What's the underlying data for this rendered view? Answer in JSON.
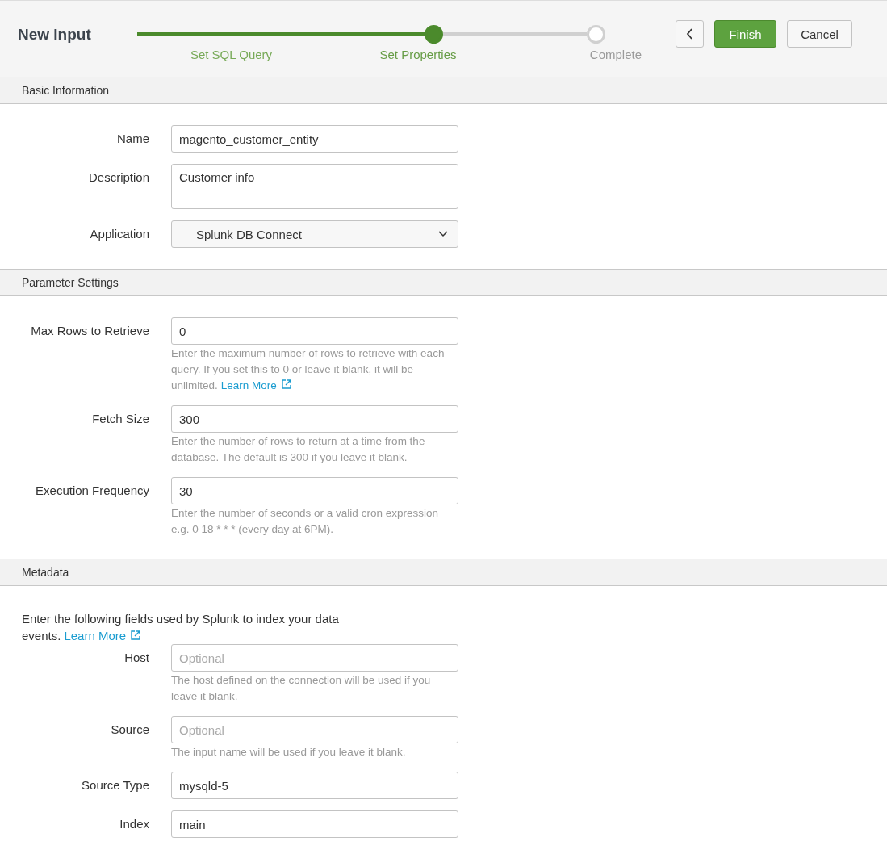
{
  "header": {
    "title": "New Input",
    "steps": [
      {
        "label": "Set SQL Query",
        "done": true,
        "selected": false
      },
      {
        "label": "Set Properties",
        "done": false,
        "selected": true
      },
      {
        "label": "Complete",
        "done": false,
        "selected": false
      }
    ],
    "buttons": [
      {
        "kind": "back"
      },
      {
        "kind": "primary",
        "label": "Finish"
      },
      {
        "kind": "secondary",
        "label": "Cancel"
      }
    ]
  },
  "sections": [
    {
      "title": "Basic Information",
      "fields": [
        {
          "label": "Name",
          "kind": "text",
          "value": "magento_customer_entity"
        },
        {
          "label": "Description",
          "kind": "textarea",
          "value": "Customer info"
        },
        {
          "label": "Application",
          "kind": "select",
          "value": "Splunk DB Connect"
        }
      ]
    },
    {
      "title": "Parameter Settings",
      "fields": [
        {
          "label": "Max Rows to Retrieve",
          "kind": "text",
          "value": "0",
          "help": {
            "text": "Enter the maximum number of rows to retrieve with each query. If you set this to 0 or leave it blank, it will be unlimited.",
            "link": "Learn More"
          }
        },
        {
          "label": "Fetch Size",
          "kind": "text",
          "value": "300",
          "help": {
            "text": "Enter the number of rows to return at a time from the database. The default is 300 if you leave it blank."
          }
        },
        {
          "label": "Execution Frequency",
          "kind": "text",
          "value": "30",
          "help": {
            "text": "Enter the number of seconds or a valid cron expression e.g. 0 18 * * * (every day at 6PM)."
          }
        }
      ]
    },
    {
      "title": "Metadata",
      "intro": {
        "text": "Enter the following fields used by Splunk to index your data events.",
        "link": "Learn More"
      },
      "fields": [
        {
          "label": "Host",
          "kind": "text",
          "placeholder": "Optional",
          "help": {
            "text": "The host defined on the connection will be used if you leave it blank."
          }
        },
        {
          "label": "Source",
          "kind": "text",
          "placeholder": "Optional",
          "help": {
            "text": "The input name will be used if you leave it blank."
          }
        },
        {
          "label": "Source Type",
          "kind": "text",
          "value": "mysqld-5"
        },
        {
          "label": "Index",
          "kind": "text",
          "value": "main"
        }
      ]
    }
  ]
}
